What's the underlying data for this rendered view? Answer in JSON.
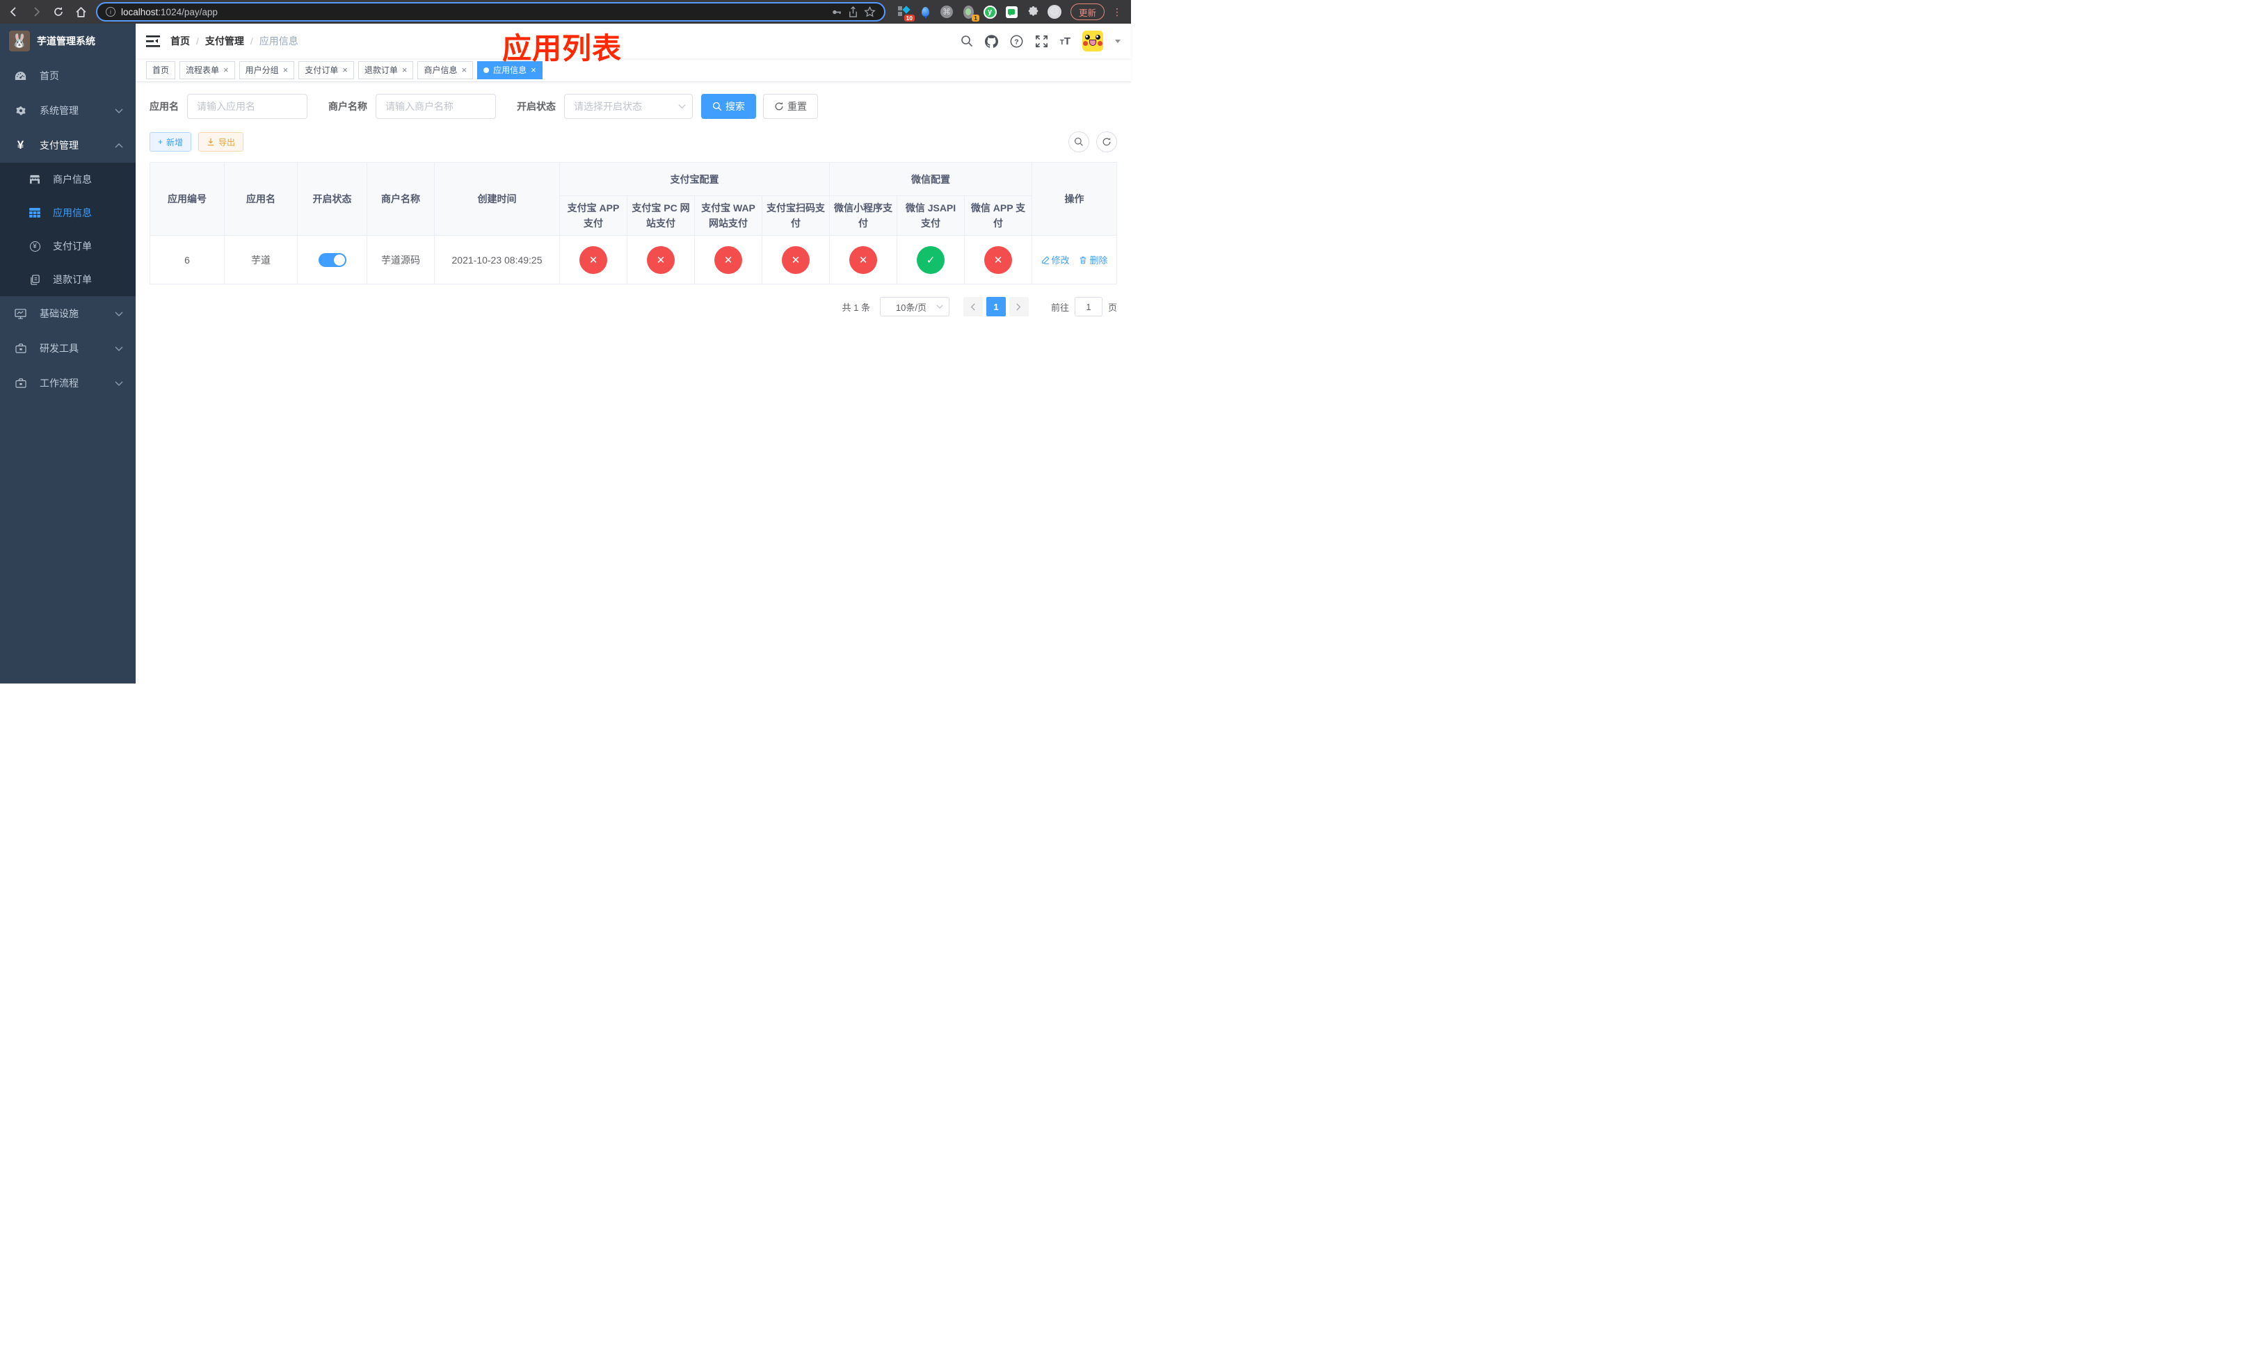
{
  "browser": {
    "url_host": "localhost",
    "url_rest": ":1024/pay/app",
    "update_label": "更新",
    "ext_badge_blocks": "10",
    "ext_badge_oval": "1",
    "ext_y_label": "y",
    "cmd_glyph": "⌘"
  },
  "sidebar": {
    "title": "芋道管理系统",
    "items": [
      "首页",
      "系统管理",
      "支付管理",
      "商户信息",
      "应用信息",
      "支付订单",
      "退款订单",
      "基础设施",
      "研发工具",
      "工作流程"
    ]
  },
  "breadcrumb": [
    "首页",
    "支付管理",
    "应用信息"
  ],
  "annotation": "应用列表",
  "tags": [
    "首页",
    "流程表单",
    "用户分组",
    "支付订单",
    "退款订单",
    "商户信息",
    "应用信息"
  ],
  "filters": {
    "app_name_label": "应用名",
    "app_name_placeholder": "请输入应用名",
    "merchant_label": "商户名称",
    "merchant_placeholder": "请输入商户名称",
    "status_label": "开启状态",
    "status_placeholder": "请选择开启状态",
    "search_label": "搜索",
    "reset_label": "重置"
  },
  "actions": {
    "add": "新增",
    "export": "导出"
  },
  "table": {
    "col_app_id": "应用编号",
    "col_app_name": "应用名",
    "col_status": "开启状态",
    "col_merchant": "商户名称",
    "col_created": "创建时间",
    "group_alipay": "支付宝配置",
    "group_wechat": "微信配置",
    "col_actions": "操作",
    "sub_cols": [
      "支付宝 APP 支付",
      "支付宝 PC 网站支付",
      "支付宝 WAP 网站支付",
      "支付宝扫码支付",
      "微信小程序支付",
      "微信 JSAPI 支付",
      "微信 APP 支付"
    ],
    "row": {
      "app_id": "6",
      "app_name": "芋道",
      "enabled": true,
      "merchant": "芋道源码",
      "created": "2021-10-23 08:49:25",
      "configs": [
        false,
        false,
        false,
        false,
        false,
        true,
        false
      ],
      "edit": "修改",
      "delete": "删除"
    }
  },
  "pagination": {
    "total": "共 1 条",
    "size": "10条/页",
    "page": "1",
    "goto_label": "前往",
    "goto_value": "1",
    "unit": "页"
  },
  "icons": {
    "close": "×",
    "plus": "+"
  },
  "colors": {
    "accent": "#409eff",
    "danger": "#f34d4d",
    "success": "#12c06a",
    "warning": "#e6a23c",
    "annotation": "#ff2800",
    "sidebar_bg": "#304156",
    "submenu_bg": "#1f2d3d"
  }
}
